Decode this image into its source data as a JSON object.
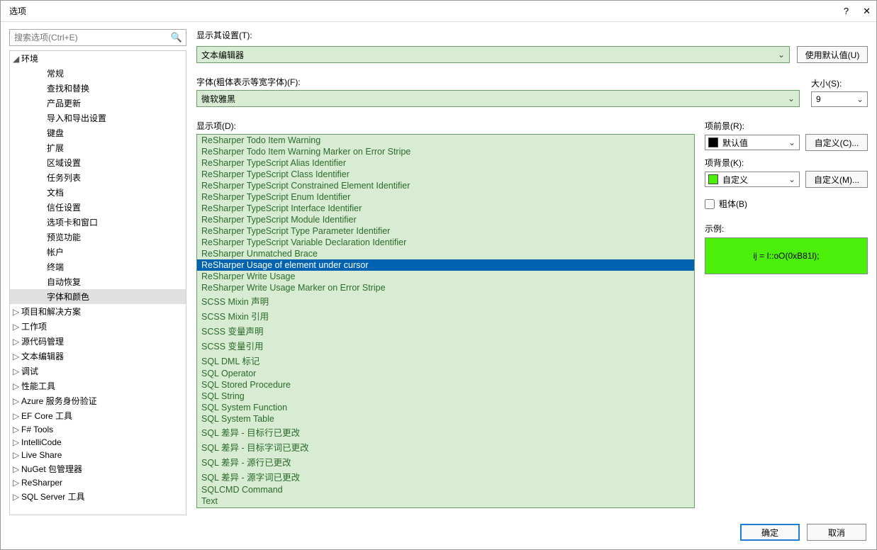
{
  "window": {
    "title": "选项",
    "help": "?",
    "close": "✕"
  },
  "search": {
    "placeholder": "搜索选项(Ctrl+E)"
  },
  "tree": {
    "root": "环境",
    "children": [
      "常规",
      "查找和替换",
      "产品更新",
      "导入和导出设置",
      "键盘",
      "扩展",
      "区域设置",
      "任务列表",
      "文档",
      "信任设置",
      "选项卡和窗口",
      "预览功能",
      "帐户",
      "终端",
      "自动恢复",
      "字体和颜色"
    ],
    "selected": "字体和颜色",
    "categories": [
      "项目和解决方案",
      "工作项",
      "源代码管理",
      "文本编辑器",
      "调试",
      "性能工具",
      "Azure 服务身份验证",
      "EF Core 工具",
      "F# Tools",
      "IntelliCode",
      "Live Share",
      "NuGet 包管理器",
      "ReSharper",
      "SQL Server 工具"
    ]
  },
  "main": {
    "show_settings_label": "显示其设置(T):",
    "show_settings_value": "文本编辑器",
    "use_defaults": "使用默认值(U)",
    "font_label": "字体(粗体表示等宽字体)(F):",
    "font_value": "微软雅黑",
    "size_label": "大小(S):",
    "size_value": "9",
    "display_label": "显示项(D):",
    "items": [
      "ReSharper Todo Item Warning",
      "ReSharper Todo Item Warning Marker on Error Stripe",
      "ReSharper TypeScript Alias Identifier",
      "ReSharper TypeScript Class Identifier",
      "ReSharper TypeScript Constrained Element Identifier",
      "ReSharper TypeScript Enum Identifier",
      "ReSharper TypeScript Interface Identifier",
      "ReSharper TypeScript Module Identifier",
      "ReSharper TypeScript Type Parameter Identifier",
      "ReSharper TypeScript Variable Declaration Identifier",
      "ReSharper Unmatched Brace",
      "ReSharper Usage of element under cursor",
      "ReSharper Write Usage",
      "ReSharper Write Usage Marker on Error Stripe",
      "SCSS Mixin 声明",
      "SCSS Mixin 引用",
      "SCSS 变量声明",
      "SCSS 变量引用",
      "SQL DML 标记",
      "SQL Operator",
      "SQL Stored Procedure",
      "SQL String",
      "SQL System Function",
      "SQL System Table",
      "SQL 差异 - 目标行已更改",
      "SQL 差异 - 目标字词已更改",
      "SQL 差异 - 源行已更改",
      "SQL 差异 - 源字词已更改",
      "SQLCMD Command",
      "Text"
    ],
    "selected_item": "ReSharper Usage of element under cursor",
    "fg_label": "项前景(R):",
    "fg_value": "默认值",
    "fg_swatch": "#000000",
    "bg_label": "项背景(K):",
    "bg_value": "自定义",
    "bg_swatch": "#4bef0a",
    "custom_btn_c": "自定义(C)...",
    "custom_btn_m": "自定义(M)...",
    "bold_label": "粗体(B)",
    "sample_label": "示例:",
    "sample_text": "ij = I::oO(0xB81l);"
  },
  "footer": {
    "ok": "确定",
    "cancel": "取消"
  }
}
